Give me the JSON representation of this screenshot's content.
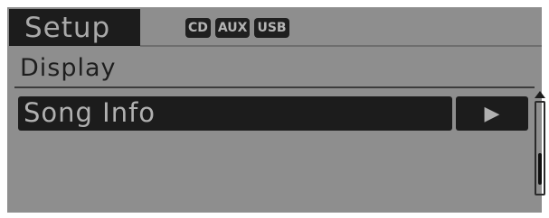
{
  "header": {
    "title": "Setup"
  },
  "sources": [
    {
      "label": "CD",
      "icon": "cd-source-badge"
    },
    {
      "label": "AUX",
      "icon": "aux-source-badge"
    },
    {
      "label": "USB",
      "icon": "usb-source-badge"
    }
  ],
  "section": {
    "title": "Display"
  },
  "menu": {
    "items": [
      {
        "label": "Song Info",
        "selected": true
      }
    ],
    "arrow_glyph": "▶"
  },
  "scrollbar": {
    "position_fraction": 0.85
  },
  "colors": {
    "screen_bg": "#8e8e8e",
    "highlight_bg": "#1c1c1c",
    "highlight_text": "#b0b0b0",
    "section_text": "#1e1e1e"
  }
}
